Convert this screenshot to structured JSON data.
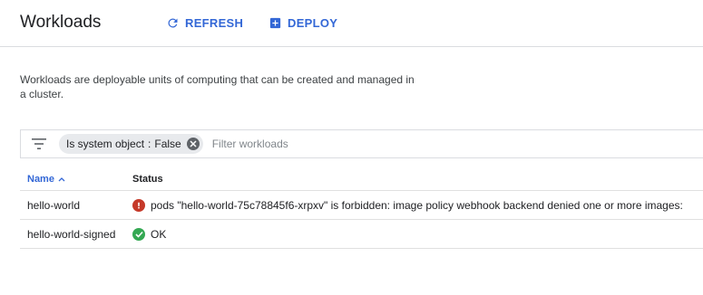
{
  "header": {
    "title": "Workloads",
    "refresh_label": "REFRESH",
    "deploy_label": "DEPLOY",
    "accent_color": "#3367d6"
  },
  "description": "Workloads are deployable units of computing that can be created and managed in a cluster.",
  "filter": {
    "chip_key": "Is system object",
    "chip_separator": ":",
    "chip_value": "False",
    "placeholder": "Filter workloads"
  },
  "table": {
    "columns": {
      "name": "Name",
      "status": "Status"
    },
    "sort_indicator": "^",
    "rows": [
      {
        "name": "hello-world",
        "status_type": "error",
        "status_icon": "error-icon",
        "status_text": "pods \"hello-world-75c78845f6-xrpxv\" is forbidden: image policy webhook backend denied one or more images:"
      },
      {
        "name": "hello-world-signed",
        "status_type": "ok",
        "status_icon": "check-circle-icon",
        "status_text": "OK"
      }
    ]
  }
}
